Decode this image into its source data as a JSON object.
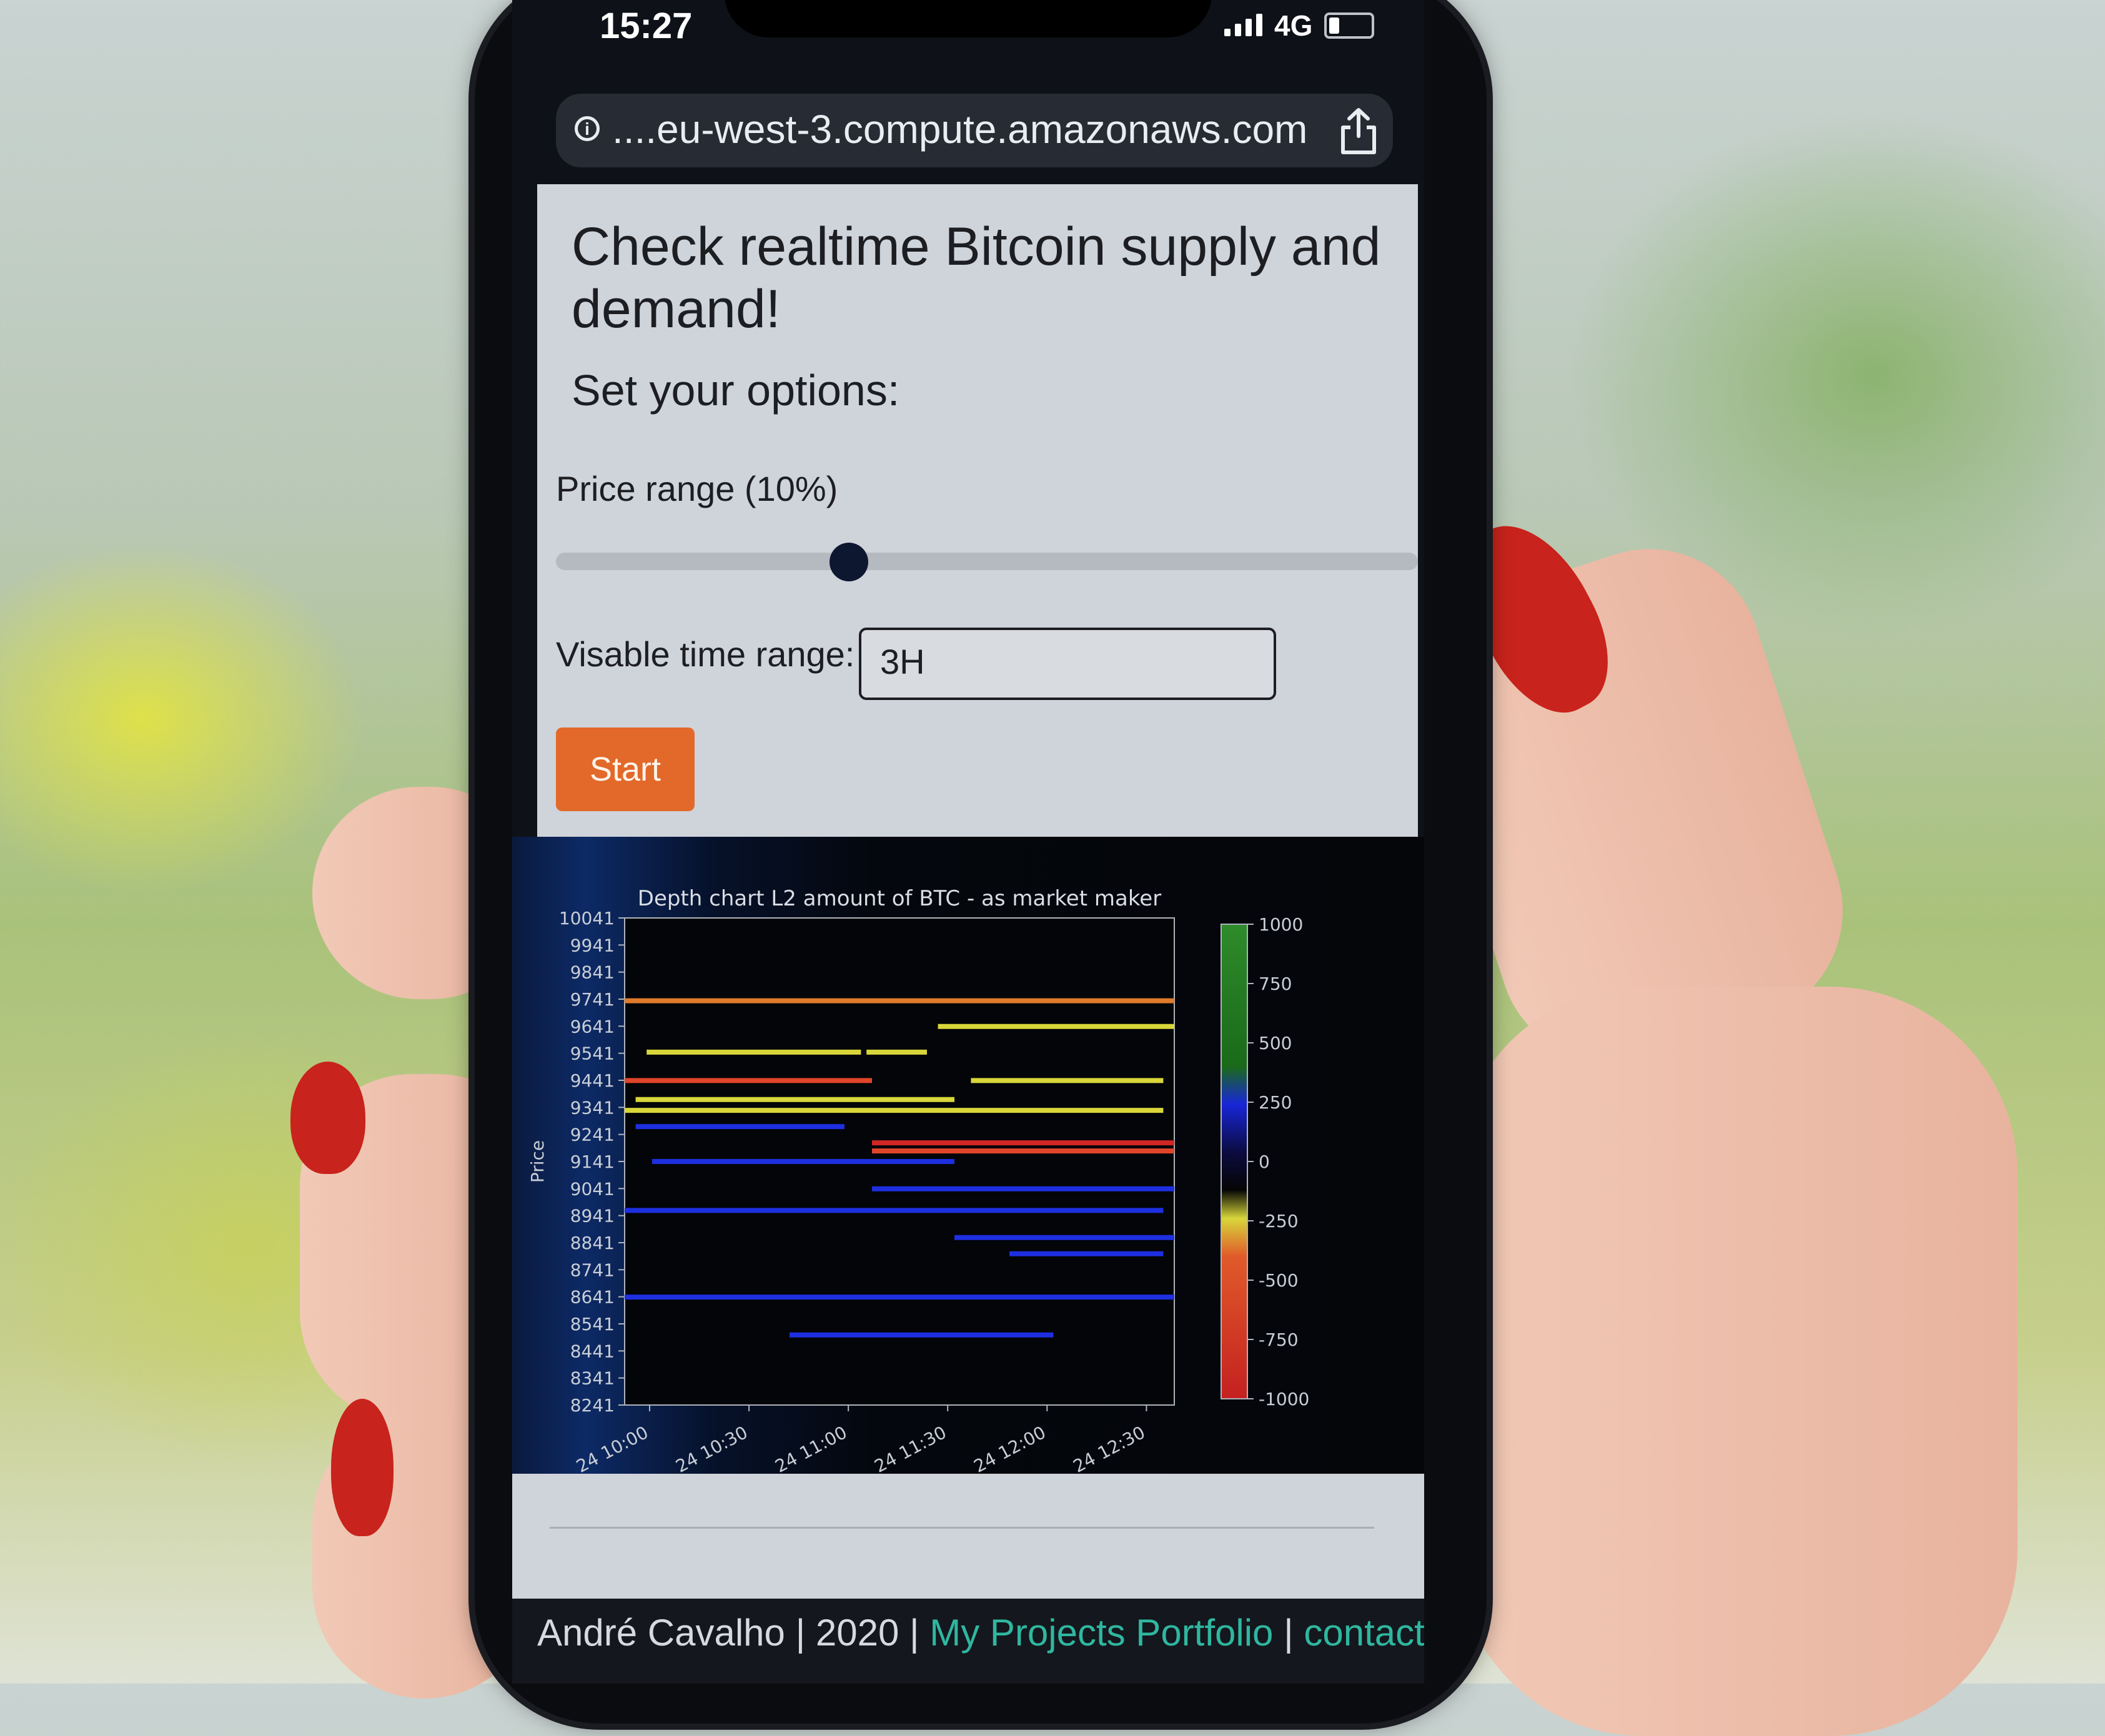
{
  "status_bar": {
    "time": "15:27",
    "network": "4G",
    "battery_level": 0.25
  },
  "browser": {
    "url": "....eu-west-3.compute.amazonaws.com",
    "info_icon": "info-icon",
    "share_icon": "share-icon"
  },
  "page": {
    "title": "Check realtime Bitcoin supply and demand!",
    "subtitle": "Set your options:",
    "price_range_label": "Price range (10%)",
    "price_range_value": 0.34,
    "time_range_label": "Visable time range:",
    "time_range_value": "3H",
    "start_button": "Start"
  },
  "chart_data": {
    "type": "heatmap",
    "title": "Depth chart L2 amount of BTC - as market maker",
    "ylabel": "Price",
    "y_ticks": [
      "10041",
      "9941",
      "9841",
      "9741",
      "9641",
      "9541",
      "9441",
      "9341",
      "9241",
      "9141",
      "9041",
      "8941",
      "8841",
      "8741",
      "8641",
      "8541",
      "8441",
      "8341",
      "8241"
    ],
    "x_ticks": [
      "24 10:00",
      "24 10:30",
      "24 11:00",
      "24 11:30",
      "24 12:00",
      "24 12:30"
    ],
    "colorbar_ticks": [
      "1000",
      "750",
      "500",
      "250",
      "0",
      "-250",
      "-500",
      "-750",
      "-1000"
    ],
    "colorbar_range": [
      -1000,
      1000
    ],
    "levels": [
      {
        "price": 9735,
        "x_start": 0.0,
        "x_end": 1.0,
        "value": -380
      },
      {
        "price": 9640,
        "x_start": 0.57,
        "x_end": 1.0,
        "value": -250
      },
      {
        "price": 9545,
        "x_start": 0.04,
        "x_end": 0.43,
        "value": -260
      },
      {
        "price": 9545,
        "x_start": 0.44,
        "x_end": 0.55,
        "value": -260
      },
      {
        "price": 9440,
        "x_start": 0.0,
        "x_end": 0.45,
        "value": -500
      },
      {
        "price": 9440,
        "x_start": 0.63,
        "x_end": 0.98,
        "value": -300
      },
      {
        "price": 9370,
        "x_start": 0.02,
        "x_end": 0.6,
        "value": -280
      },
      {
        "price": 9330,
        "x_start": 0.0,
        "x_end": 0.98,
        "value": -250
      },
      {
        "price": 9270,
        "x_start": 0.02,
        "x_end": 0.4,
        "value": 300
      },
      {
        "price": 9210,
        "x_start": 0.45,
        "x_end": 1.0,
        "value": -650
      },
      {
        "price": 9180,
        "x_start": 0.45,
        "x_end": 1.0,
        "value": -450
      },
      {
        "price": 9141,
        "x_start": 0.05,
        "x_end": 0.6,
        "value": 350
      },
      {
        "price": 9040,
        "x_start": 0.45,
        "x_end": 1.0,
        "value": 320
      },
      {
        "price": 8960,
        "x_start": 0.0,
        "x_end": 0.98,
        "value": 330
      },
      {
        "price": 8860,
        "x_start": 0.6,
        "x_end": 1.0,
        "value": 300
      },
      {
        "price": 8800,
        "x_start": 0.7,
        "x_end": 0.98,
        "value": 320
      },
      {
        "price": 8640,
        "x_start": 0.0,
        "x_end": 1.0,
        "value": 360
      },
      {
        "price": 8500,
        "x_start": 0.3,
        "x_end": 0.78,
        "value": 340
      }
    ]
  },
  "footer": {
    "author": "André Cavalho | 2020 | ",
    "portfolio_link": "My Projects Portfolio",
    "separator": " | ",
    "contact_link": "contact"
  },
  "colors": {
    "accent": "#e2692a",
    "link": "#2fb7a0",
    "page_bg": "#cfd3da"
  }
}
